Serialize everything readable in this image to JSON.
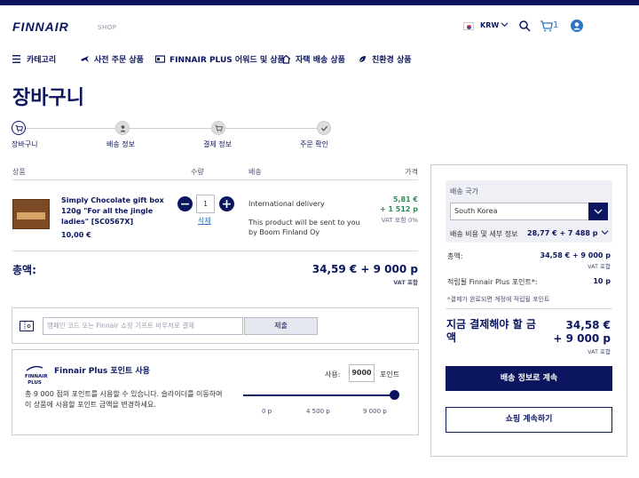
{
  "header": {
    "logo": "FINNAIR",
    "shop": "SHOP",
    "currency": "KRW",
    "cart_count": "1"
  },
  "nav": {
    "items": [
      "카테고리",
      "사전 주문 상품",
      "FINNAIR PLUS 어워드 및 상품",
      "자택 배송 상품",
      "친환경 상품"
    ]
  },
  "page_title": "장바구니",
  "steps": [
    "장바구니",
    "배송 정보",
    "결제 정보",
    "주문 확인"
  ],
  "table": {
    "headers": [
      "상품",
      "수량",
      "배송",
      "가격"
    ],
    "item": {
      "name": "Simply Chocolate gift box 120g \"For all the jingle ladies\" [SC0567X]",
      "price": "10,00 €",
      "quantity": "1",
      "delete": "삭제",
      "shipping": "International delivery",
      "shipping_note": "This product will be sent to you by Boom Finland Oy",
      "price_eur": "5,81 €",
      "price_points": "+ 1 512 p",
      "vat": "VAT 포함 0%"
    }
  },
  "total": {
    "label": "총액:",
    "value": "34,59 € + 9 000 p",
    "vat": "VAT 포함"
  },
  "promo": {
    "placeholder": "캠페인 코드 또는 Finnair 쇼핑 기프트 바우처로 결제",
    "button": "제출"
  },
  "finnair_plus": {
    "logo": "FINNAIR PLUS",
    "title": "Finnair Plus 포인트 사용",
    "description": "총 9 000 점의 포인트를 사용할 수 있습니다. 슬라이더를 이동하여 이 상품에 사용할 포인트 금액을 변경하세요.",
    "use_label": "사용:",
    "use_value": "9000",
    "points_label": "포인트",
    "ticks": [
      "0 p",
      "4 500 p",
      "9 000 p"
    ],
    "slider_fraction": 1.0
  },
  "sidebar": {
    "country_label": "배송 국가",
    "country": "South Korea",
    "shipping_label": "배송 비용 및 세부 정보",
    "shipping_value": "28,77 € + 7 488 p",
    "total_label": "총액:",
    "total_value": "34,58 € + 9 000 p",
    "total_vat": "VAT 포함",
    "points_label": "적립될 Finnair Plus 포인트*:",
    "points_value": "10 p",
    "note": "*결제가 완료되면 계정에 적립될 포인트",
    "pay_label": "지금 결제해야 할 금액",
    "pay_eur": "34,58 €",
    "pay_points": "+ 9 000 p",
    "pay_vat": "VAT 포함",
    "primary_button": "배송 정보로 계속",
    "secondary_button": "쇼핑 계속하기"
  },
  "colors": {
    "brand": "#0b1560",
    "accent": "#2c74c4",
    "green": "#2e8b57"
  }
}
